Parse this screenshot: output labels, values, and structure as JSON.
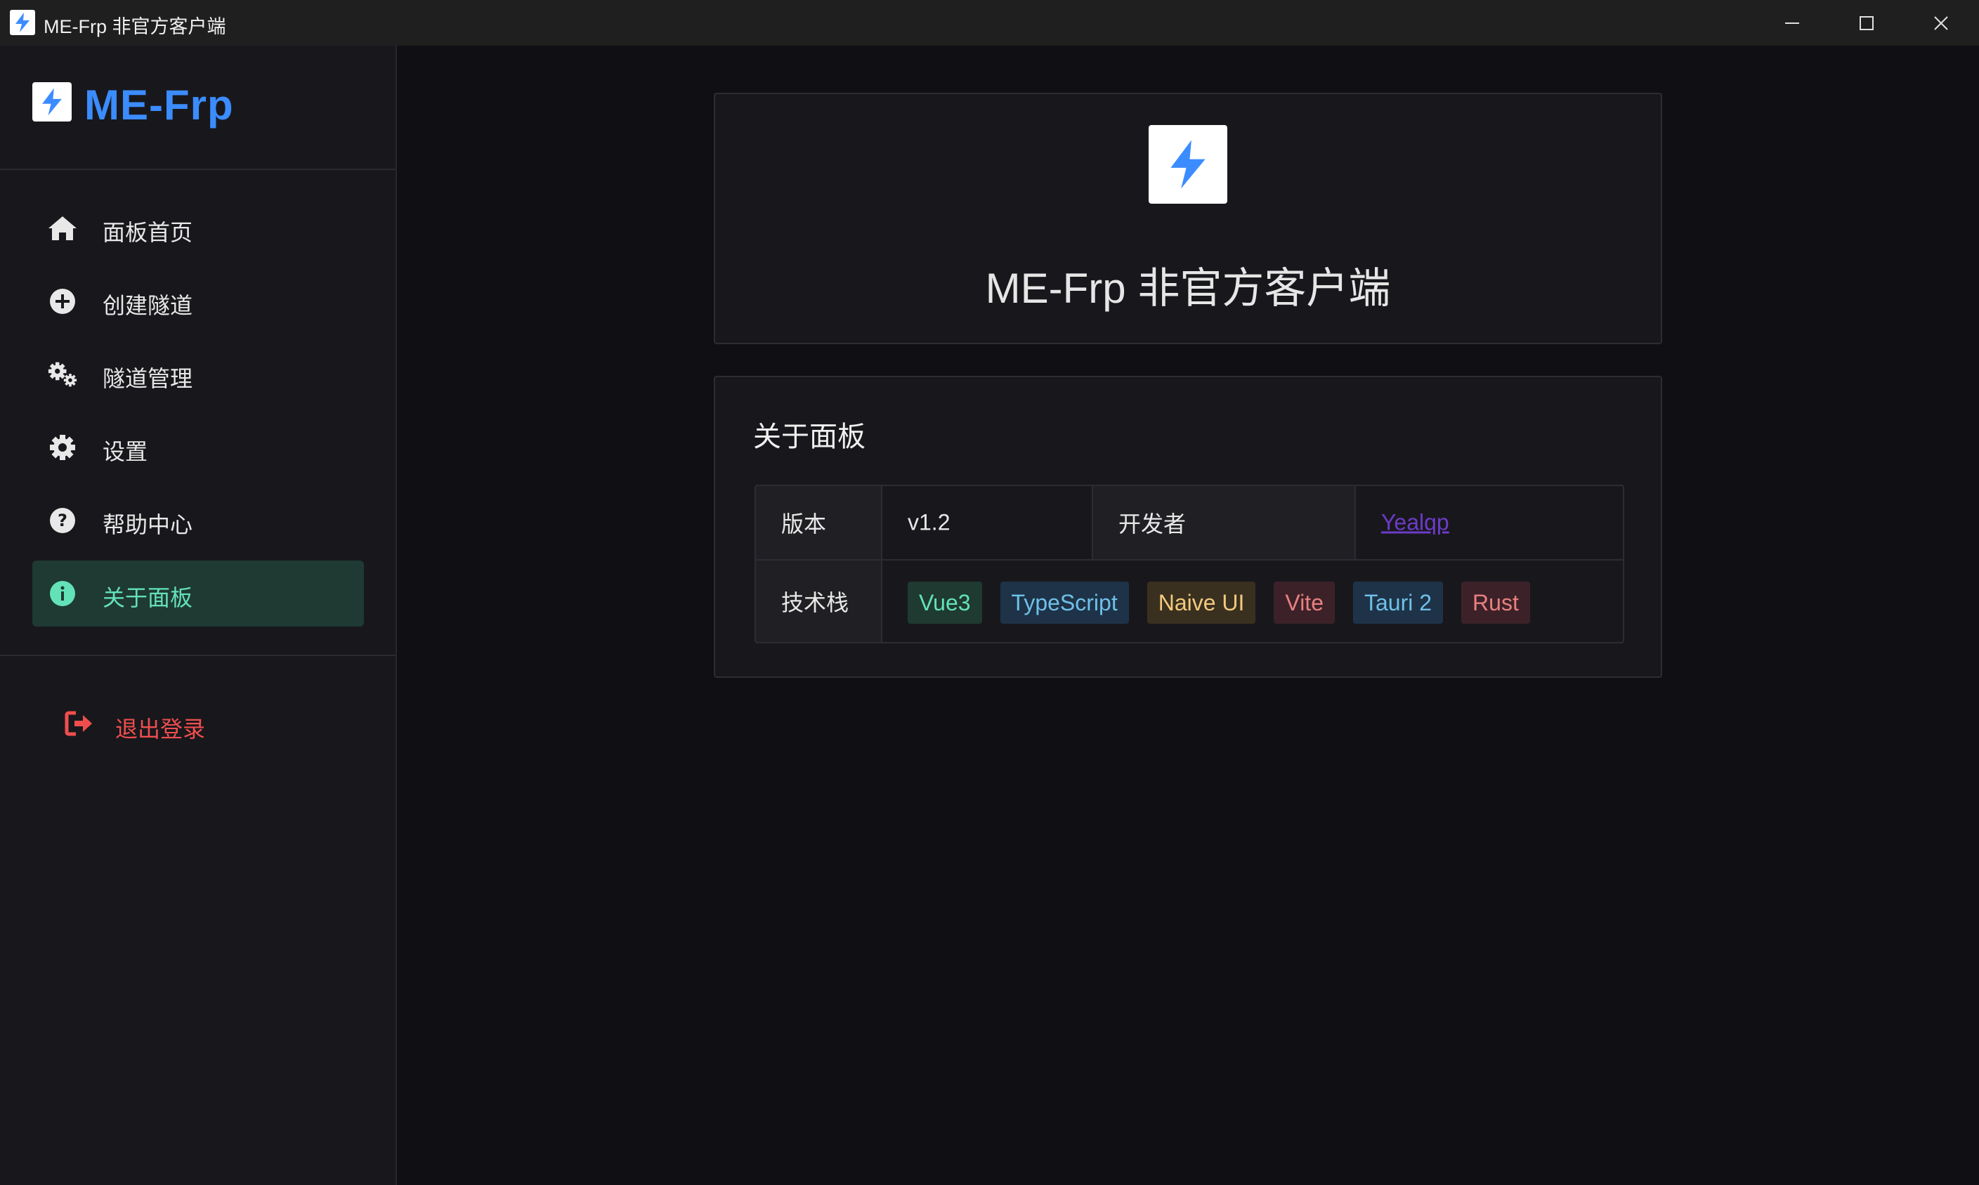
{
  "window": {
    "title": "ME-Frp 非官方客户端"
  },
  "sidebar": {
    "brand": "ME-Frp",
    "items": [
      {
        "label": "面板首页",
        "icon": "home-icon"
      },
      {
        "label": "创建隧道",
        "icon": "plus-circle-icon"
      },
      {
        "label": "隧道管理",
        "icon": "gears-icon"
      },
      {
        "label": "设置",
        "icon": "gear-icon"
      },
      {
        "label": "帮助中心",
        "icon": "question-circle-icon"
      },
      {
        "label": "关于面板",
        "icon": "info-circle-icon",
        "active": true
      }
    ],
    "logout_label": "退出登录"
  },
  "hero": {
    "title": "ME-Frp 非官方客户端"
  },
  "about": {
    "title": "关于面板",
    "version_label": "版本",
    "version_value": "v1.2",
    "developer_label": "开发者",
    "developer_value": "Yealqp",
    "stack_label": "技术栈",
    "stack_tags": [
      "Vue3",
      "TypeScript",
      "Naive UI",
      "Vite",
      "Tauri 2",
      "Rust"
    ]
  },
  "colors": {
    "accent": "#3b8cff",
    "active": "#63e2b7",
    "danger": "#f04e4e",
    "link": "#6d3ac8"
  }
}
